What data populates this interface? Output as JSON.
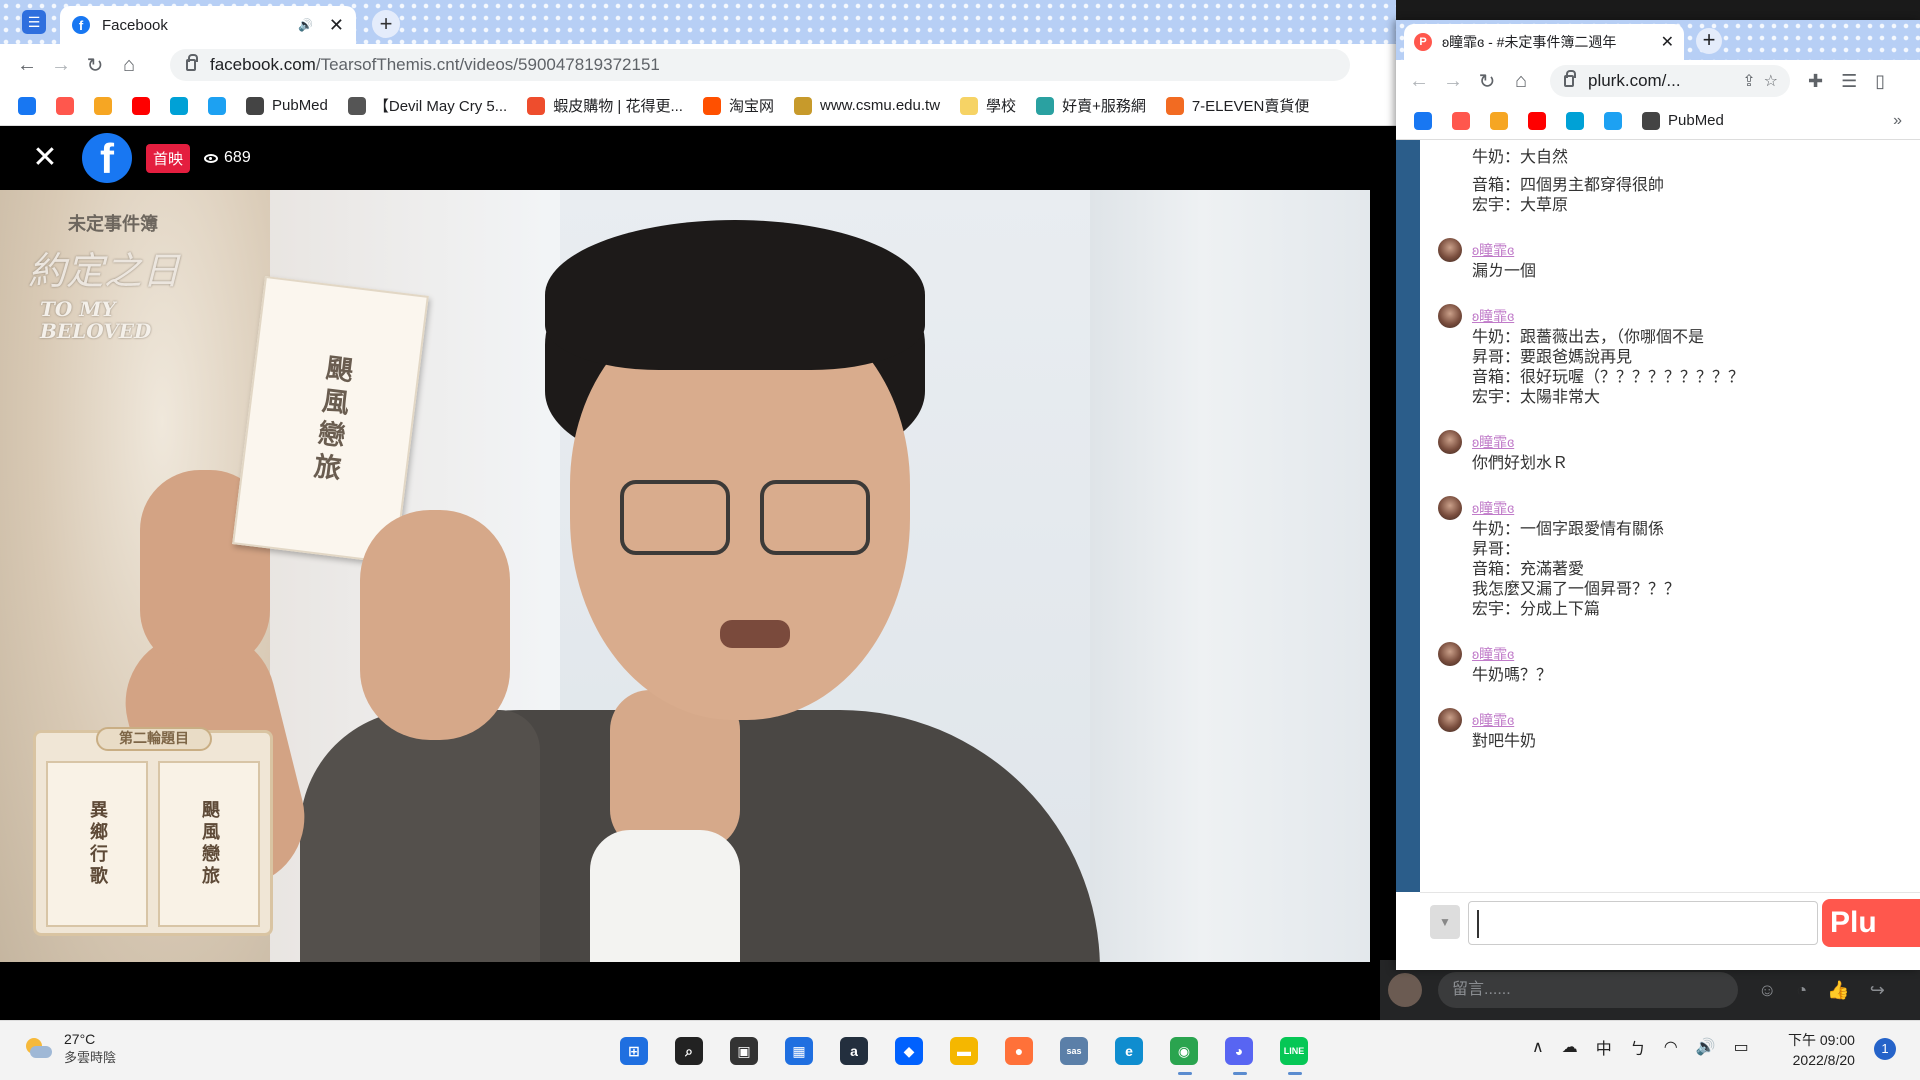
{
  "main_browser": {
    "tab": {
      "title": "Facebook"
    },
    "url": {
      "host": "facebook.com",
      "path": "/TearsofThemis.cnt/videos/590047819372151"
    },
    "bookmarks": [
      {
        "label": "",
        "icon": "facebook-icon",
        "color": "#1877f2"
      },
      {
        "label": "",
        "icon": "plurk-icon",
        "color": "#ff574d"
      },
      {
        "label": "",
        "icon": "rss-icon",
        "color": "#f6a623"
      },
      {
        "label": "",
        "icon": "youtube-icon",
        "color": "#ff0000"
      },
      {
        "label": "",
        "icon": "bilibili-icon",
        "color": "#00a1d6"
      },
      {
        "label": "",
        "icon": "twitter-icon",
        "color": "#1da1f2"
      },
      {
        "label": "PubMed",
        "icon": "pubmed-icon",
        "color": "#444444"
      },
      {
        "label": "【Devil May Cry 5...",
        "icon": "dmc-icon",
        "color": "#555555"
      },
      {
        "label": "蝦皮購物 | 花得更...",
        "icon": "shopee-icon",
        "color": "#ee4d2d"
      },
      {
        "label": "淘宝网",
        "icon": "taobao-icon",
        "color": "#ff5000"
      },
      {
        "label": "www.csmu.edu.tw",
        "icon": "csmu-icon",
        "color": "#c79a2b"
      },
      {
        "label": "學校",
        "icon": "folder-icon",
        "color": "#f6d365"
      },
      {
        "label": "好賣+服務網",
        "icon": "shop-icon",
        "color": "#2aa1a1"
      },
      {
        "label": "7-ELEVEN賣貨便",
        "icon": "seven-icon",
        "color": "#f26b22"
      }
    ]
  },
  "video": {
    "premiere_badge": "首映",
    "viewer_count": "689",
    "logo_top": "未定事件簿",
    "logo_main": "約定之日",
    "logo_sub_1": "TO MY",
    "logo_sub_2": "BELOVED",
    "held_card": "颶風戀旅",
    "round_title": "第二輪題目",
    "round_cards": [
      "異鄉行歌",
      "颶風戀旅"
    ]
  },
  "plurk_browser": {
    "tab": {
      "title": "ʚ瞳霏ɞ - #未定事件簿二週年"
    },
    "url": "plurk.com/...",
    "bookmarks_label": "PubMed",
    "feed": [
      {
        "user": "",
        "lines": [
          "牛奶：大自然",
          "",
          "音箱：四個男主都穿得很帥",
          "宏宇：大草原"
        ]
      },
      {
        "user": "ʚ瞳霏ɞ",
        "lines": [
          "漏ㄌ一個"
        ]
      },
      {
        "user": "ʚ瞳霏ɞ",
        "lines": [
          "牛奶：跟薔薇出去，（你哪個不是",
          "昇哥：要跟爸媽說再見",
          "音箱：很好玩喔（？？？？？？？？？",
          "宏宇：太陽非常大"
        ]
      },
      {
        "user": "ʚ瞳霏ɞ",
        "lines": [
          "你們好划水Ｒ"
        ]
      },
      {
        "user": "ʚ瞳霏ɞ",
        "lines": [
          "牛奶：一個字跟愛情有關係",
          "昇哥：",
          "音箱：充滿著愛",
          "我怎麼又漏了一個昇哥？？？",
          "宏宇：分成上下篇"
        ]
      },
      {
        "user": "ʚ瞳霏ɞ",
        "lines": [
          "牛奶嗎？？"
        ]
      },
      {
        "user": "ʚ瞳霏ɞ",
        "lines": [
          "對吧牛奶"
        ]
      }
    ],
    "plurk_button": "Plu"
  },
  "fb_comment": {
    "placeholder": "留言......"
  },
  "taskbar": {
    "weather_temp": "27°C",
    "weather_desc": "多雲時陰",
    "ime": "中",
    "ime2": "ㄅ",
    "time": "下午 09:00",
    "date": "2022/8/20",
    "notifications": "1",
    "apps": [
      {
        "name": "windows-start",
        "color": "#1f6fe0",
        "glyph": "⊞"
      },
      {
        "name": "search",
        "color": "#222222",
        "glyph": "⌕"
      },
      {
        "name": "task-view",
        "color": "#333333",
        "glyph": "▣"
      },
      {
        "name": "microsoft-store",
        "color": "#1f6fe0",
        "glyph": "▦"
      },
      {
        "name": "amazon",
        "color": "#232f3e",
        "glyph": "a"
      },
      {
        "name": "dropbox",
        "color": "#0061fe",
        "glyph": "◆"
      },
      {
        "name": "file-explorer",
        "color": "#f5b700",
        "glyph": "▬"
      },
      {
        "name": "firefox",
        "color": "#ff7139",
        "glyph": "●"
      },
      {
        "name": "sas",
        "color": "#5b7fa8",
        "glyph": "sas"
      },
      {
        "name": "edge",
        "color": "#0f8dcf",
        "glyph": "e"
      },
      {
        "name": "chrome",
        "color": "#2aa44f",
        "glyph": "◉"
      },
      {
        "name": "discord",
        "color": "#5865f2",
        "glyph": "◕"
      },
      {
        "name": "line",
        "color": "#06c755",
        "glyph": "LINE"
      }
    ]
  }
}
